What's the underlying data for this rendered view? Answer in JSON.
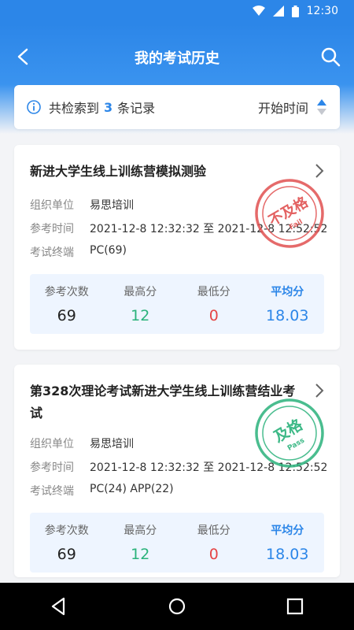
{
  "status_bar": {
    "time": "12:30"
  },
  "header": {
    "title": "我的考试历史"
  },
  "summary": {
    "prefix": "共检索到",
    "count": "3",
    "suffix": "条记录",
    "sort_label": "开始时间"
  },
  "labels": {
    "org": "组织单位",
    "time": "参考时间",
    "terminal": "考试终端",
    "attempts": "参考次数",
    "max": "最高分",
    "min": "最低分",
    "avg": "平均分"
  },
  "exams": [
    {
      "title": "新进大学生线上训练营模拟测验",
      "org": "易思培训",
      "time": "2021-12-8 12:32:32 至 2021-12-8 12:52:52",
      "terminal": "PC(69)",
      "attempts": "69",
      "max": "12",
      "min": "0",
      "avg": "18.03",
      "stamp_text": "不及格",
      "stamp_sub": "Fail",
      "stamp_color": "#e05050"
    },
    {
      "title": "第328次理论考试新进大学生线上训练营结业考试",
      "org": "易思培训",
      "time": "2021-12-8 12:32:32 至 2021-12-8 12:52:52",
      "terminal": "PC(24)  APP(22)",
      "attempts": "69",
      "max": "12",
      "min": "0",
      "avg": "18.03",
      "stamp_text": "及格",
      "stamp_sub": "Pass",
      "stamp_color": "#2ab27b"
    }
  ]
}
